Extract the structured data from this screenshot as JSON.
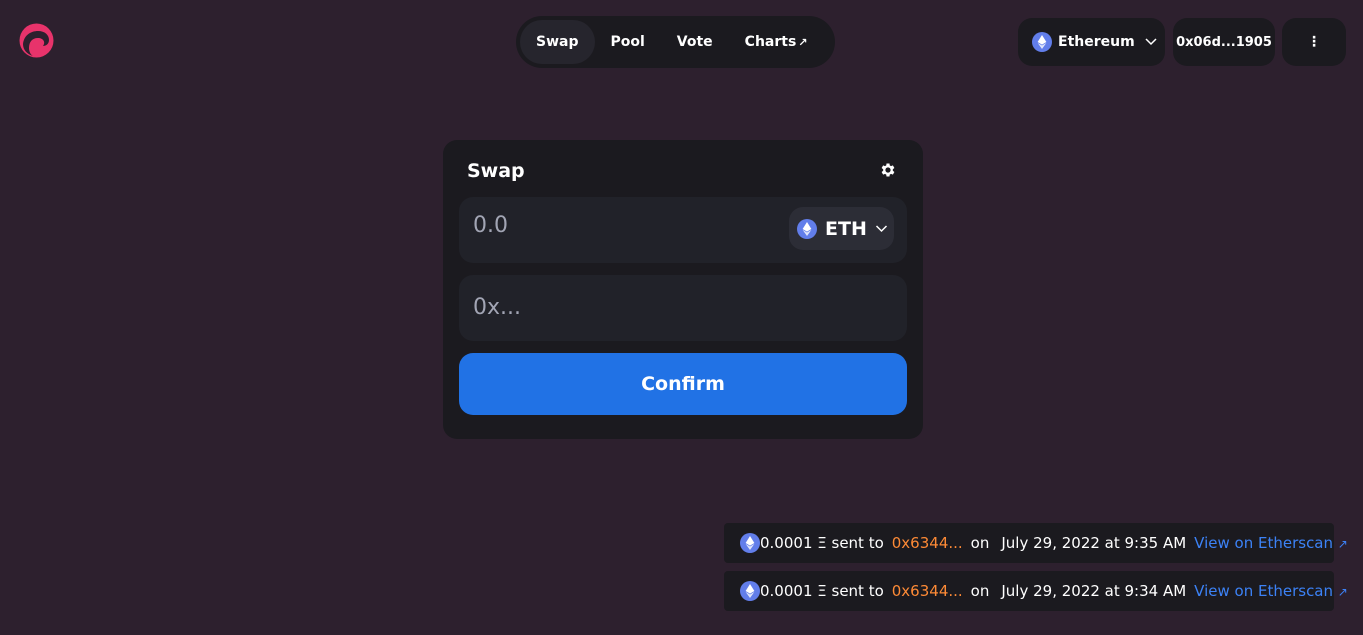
{
  "colors": {
    "background": "#2d202e",
    "surface": "#1b1a1f",
    "input_surface": "#212229",
    "accent": "#2172e5",
    "brand": "#e8336b",
    "eth": "#627eea",
    "address": "#fd8a36",
    "link": "#3c82f6"
  },
  "nav": {
    "items": [
      {
        "label": "Swap",
        "active": true
      },
      {
        "label": "Pool"
      },
      {
        "label": "Vote"
      },
      {
        "label": "Charts",
        "external_icon": "↗"
      }
    ]
  },
  "header": {
    "network_label": "Ethereum",
    "network_icon": "eth-icon",
    "account_label": "0x06d...1905",
    "more_label": "⋮"
  },
  "swap": {
    "title": "Swap",
    "amount_placeholder": "0.0",
    "token_label": "ETH",
    "address_placeholder": "0x...",
    "confirm_label": "Confirm"
  },
  "transactions": [
    {
      "amount_text": "0.0001 Ξ sent to",
      "address": "0x6344...",
      "on_text": "on",
      "date": "July 29, 2022 at 9:35 AM",
      "link_label": "View on Etherscan"
    },
    {
      "amount_text": "0.0001 Ξ sent to",
      "address": "0x6344...",
      "on_text": "on",
      "date": "July 29, 2022 at 9:34 AM",
      "link_label": "View on Etherscan"
    }
  ]
}
